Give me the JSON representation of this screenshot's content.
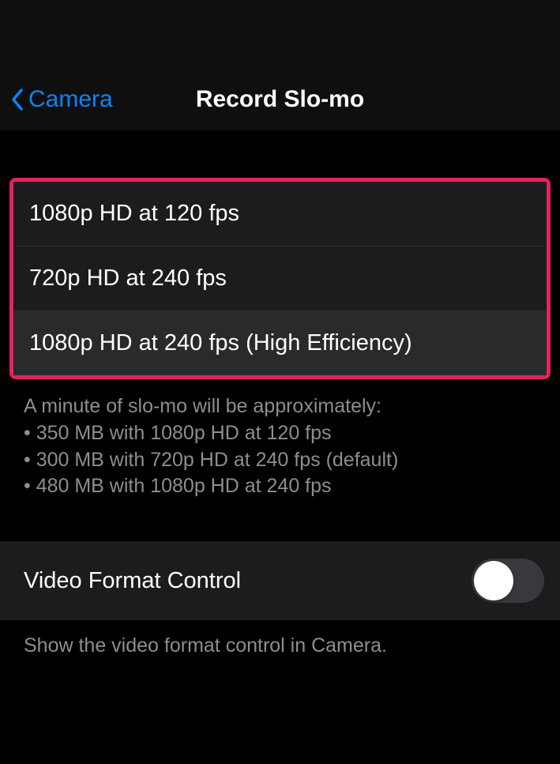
{
  "nav": {
    "back_label": "Camera",
    "title": "Record Slo-mo"
  },
  "options": [
    "1080p HD at 120 fps",
    "720p HD at 240 fps",
    "1080p HD at 240 fps (High Efficiency)"
  ],
  "footer": {
    "intro": "A minute of slo-mo will be approximately:",
    "line1": "• 350 MB with 1080p HD at 120 fps",
    "line2": "• 300 MB with 720p HD at 240 fps (default)",
    "line3": "• 480 MB with 1080p HD at 240 fps"
  },
  "format_control": {
    "label": "Video Format Control",
    "footer": "Show the video format control in Camera.",
    "enabled": false
  }
}
